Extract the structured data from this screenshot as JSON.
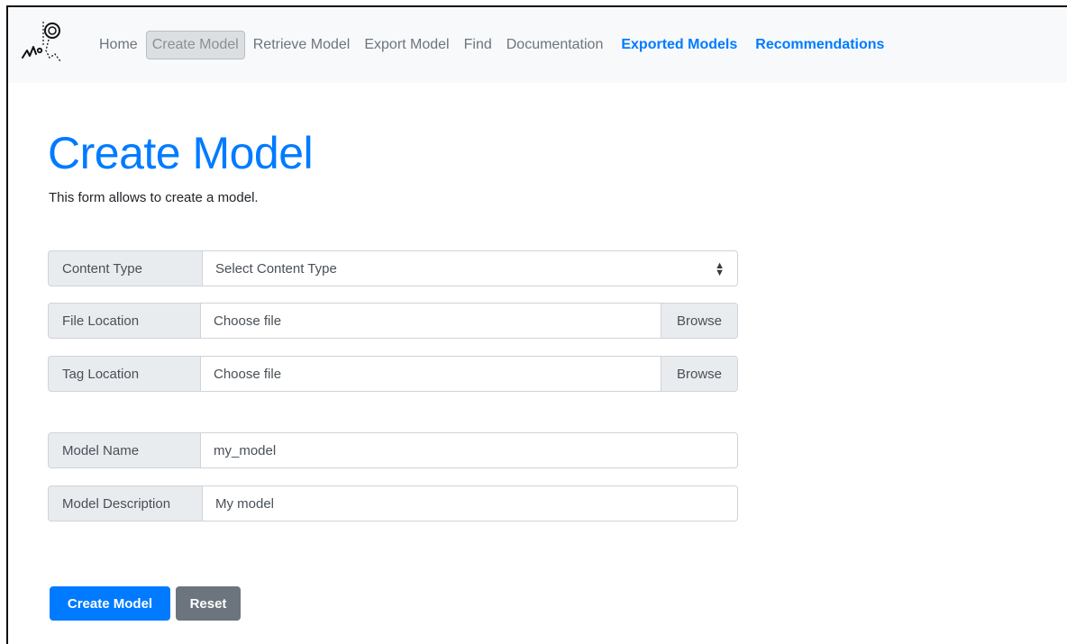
{
  "navbar": {
    "items": [
      {
        "label": "Home"
      },
      {
        "label": "Create Model"
      },
      {
        "label": "Retrieve Model"
      },
      {
        "label": "Export Model"
      },
      {
        "label": "Find"
      },
      {
        "label": "Documentation"
      },
      {
        "label": "Exported Models"
      },
      {
        "label": "Recommendations"
      }
    ],
    "active_index": 1
  },
  "page": {
    "title": "Create Model",
    "subtitle": "This form allows to create a model."
  },
  "form": {
    "content_type": {
      "label": "Content Type",
      "selected": "Select Content Type"
    },
    "file_location": {
      "label": "File Location",
      "value": "Choose file",
      "browse": "Browse"
    },
    "tag_location": {
      "label": "Tag Location",
      "value": "Choose file",
      "browse": "Browse"
    },
    "model_name": {
      "label": "Model Name",
      "value": "my_model"
    },
    "model_description": {
      "label": "Model Description",
      "value": "My model"
    }
  },
  "buttons": {
    "create": "Create Model",
    "reset": "Reset"
  },
  "colors": {
    "primary": "#007bff",
    "secondary": "#6c757d",
    "navbar_bg": "#f8f9fa",
    "addon_bg": "#e9ecef"
  }
}
